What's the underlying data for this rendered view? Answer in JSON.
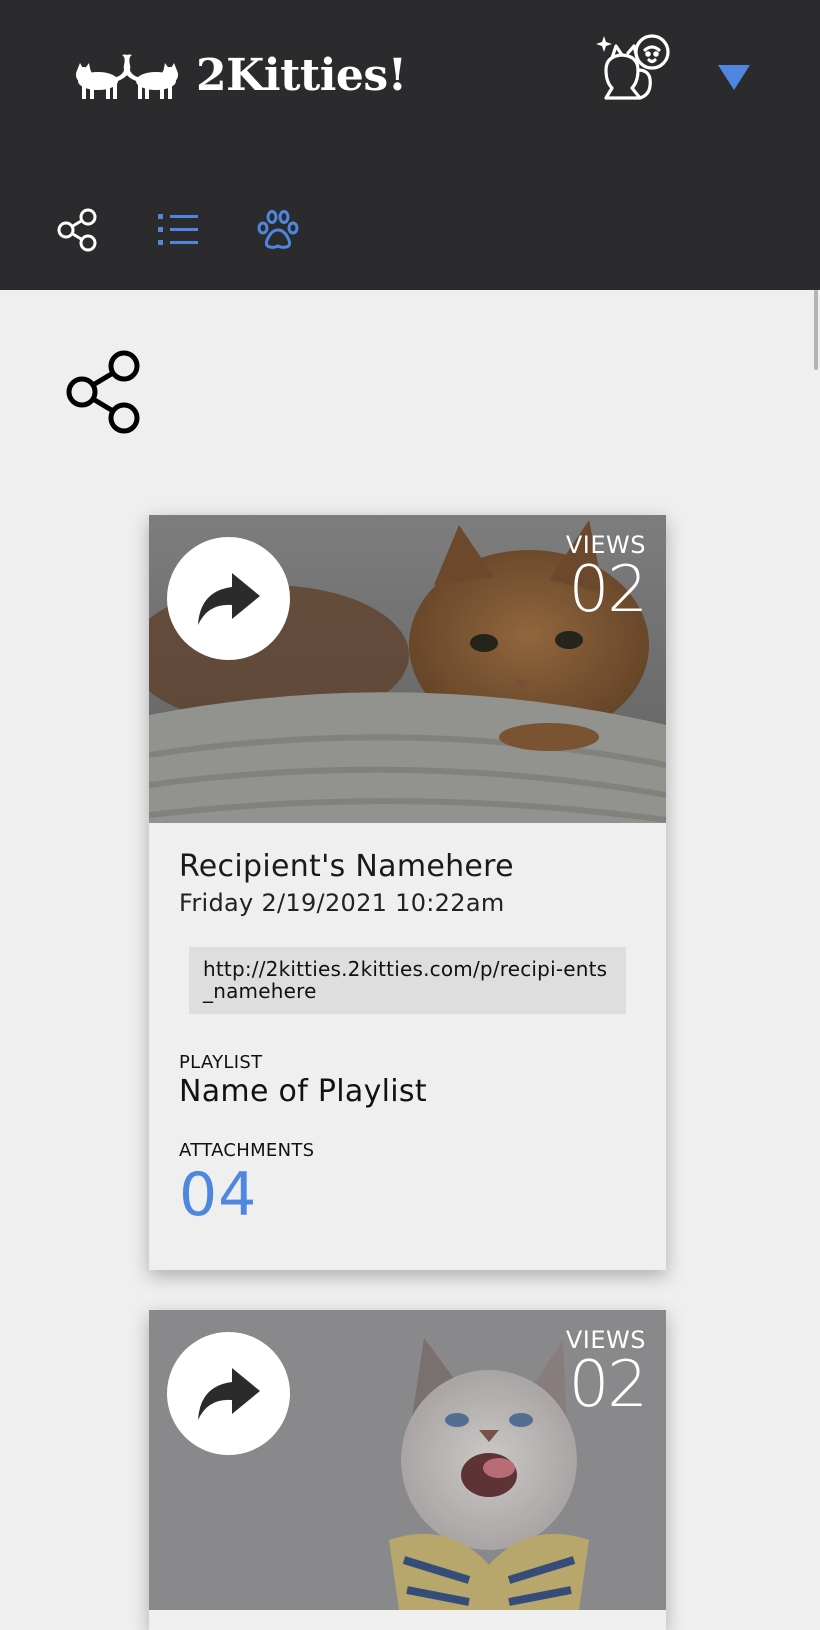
{
  "app": {
    "brand_name": "2Kitties!"
  },
  "colors": {
    "header_bg": "#2b2b2d",
    "accent": "#4f87e0",
    "page_bg": "#efefef"
  },
  "nav": {
    "items": [
      {
        "icon": "share-nodes-icon"
      },
      {
        "icon": "list-icon"
      },
      {
        "icon": "paw-icon"
      }
    ]
  },
  "section": {
    "icon": "share-nodes-icon"
  },
  "cards": [
    {
      "views_label": "VIEWS",
      "views_count": "02",
      "recipient": "Recipient's Namehere",
      "date": "Friday 2/19/2021 10:22am",
      "url": "http://2kitties.2kitties.com/p/recipi-ents_namehere",
      "playlist_label": "PLAYLIST",
      "playlist_name": "Name of Playlist",
      "attachments_label": "ATTACHMENTS",
      "attachments_count": "04"
    },
    {
      "views_label": "VIEWS",
      "views_count": "02"
    }
  ]
}
